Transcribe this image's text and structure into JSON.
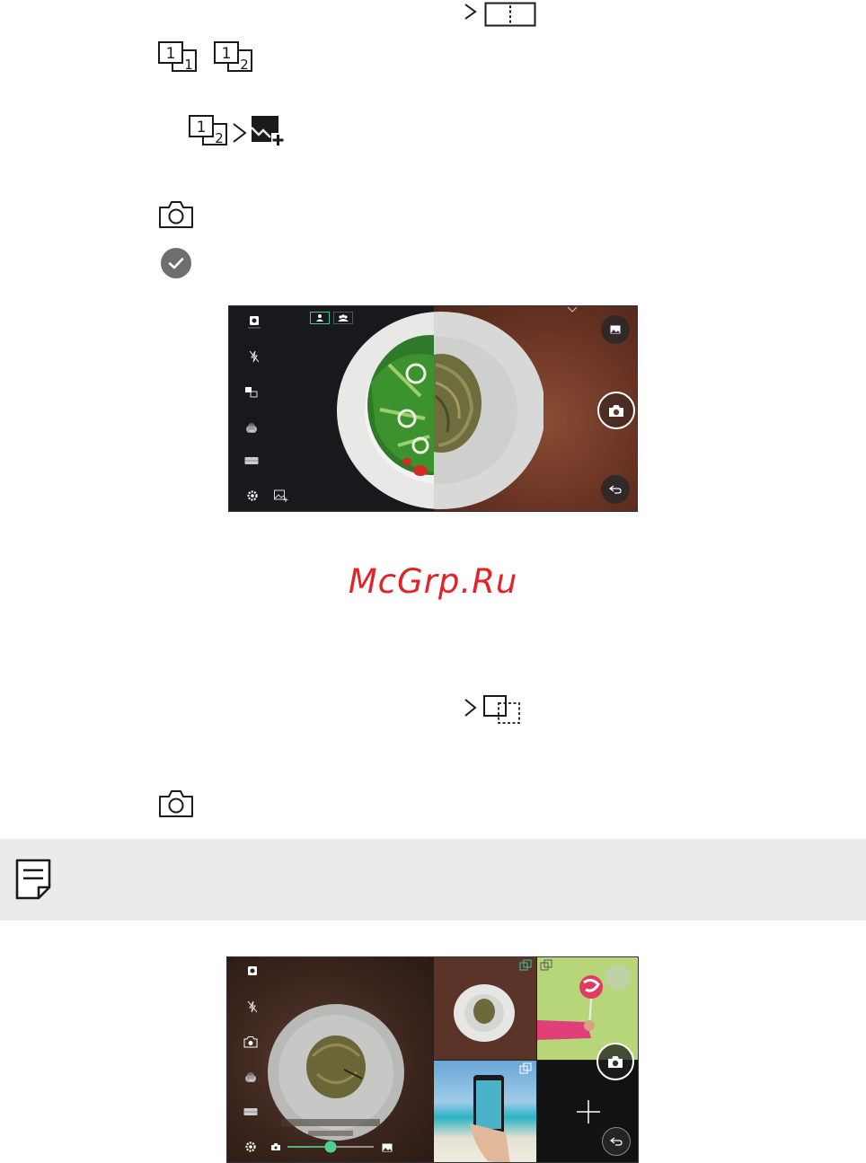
{
  "watermark": {
    "text": "McGrp.Ru"
  },
  "icons": {
    "split_view": "split-view-icon",
    "grid_1_1": "grid-1-1-icon",
    "grid_1_2": "grid-1-2-icon",
    "add_image": "add-image-icon",
    "camera": "camera-icon",
    "checkmark": "checkmark-circle-icon",
    "note": "note-icon",
    "overlay": "overlay-frame-icon"
  },
  "stack_labels": {
    "one": "1",
    "first_sub": "1",
    "second_sub": "2"
  },
  "colors": {
    "watermark": "#e0242a",
    "note_bar": "#ebebeb",
    "slider": "#4ecf9a",
    "mode_active": "#3fc59b"
  }
}
